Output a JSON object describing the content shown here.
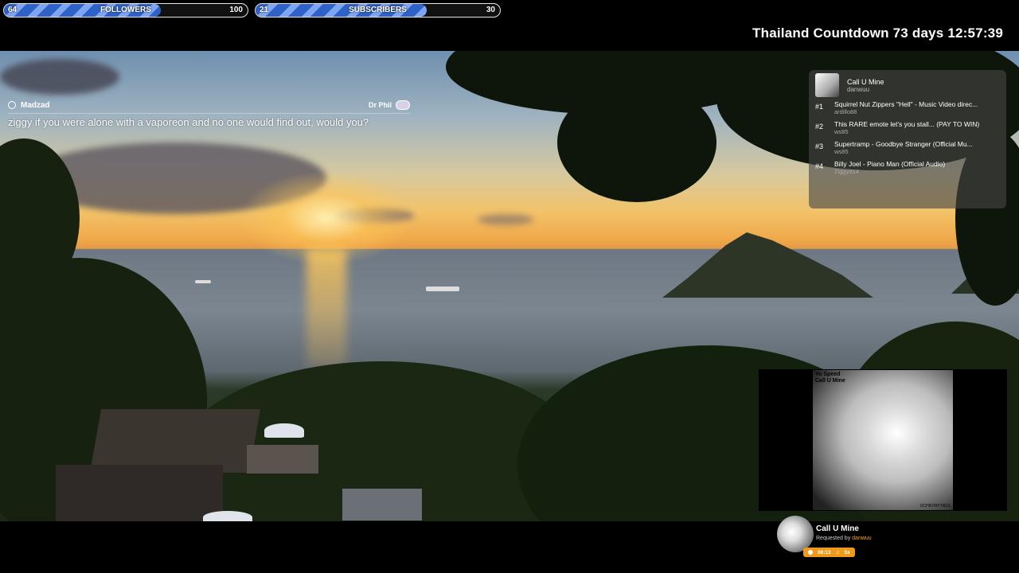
{
  "goals": {
    "followers": {
      "current": "64",
      "label": "FOLLOWERS",
      "target": "100"
    },
    "subscribers": {
      "current": "21",
      "label": "SUBSCRIBERS",
      "target": "30"
    }
  },
  "countdown": "Thailand Countdown 73 days 12:57:39",
  "chat": {
    "username": "Madzad",
    "tag": "Dr Phil",
    "message": "ziggy if you were alone with a vaporeon and no one would find out, would you?"
  },
  "queue": {
    "now_playing": {
      "title": "Call U Mine",
      "requester": "danwuu"
    },
    "items": [
      {
        "num": "#1",
        "title": "Squirrel Nut Zippers \"Hell\" - Music Video direc...",
        "requester": "ardillo88"
      },
      {
        "num": "#2",
        "title": "This RARE emote let's you stall... (PAY TO WIN)",
        "requester": "ws85"
      },
      {
        "num": "#3",
        "title": "Supertramp - Goodbye Stranger (Official Mu...",
        "requester": "ws85"
      },
      {
        "num": "#4",
        "title": "Billy Joel - Piano Man (Official Audio)",
        "requester": "Ziggy314"
      }
    ]
  },
  "album": {
    "artist": "Yo Speed",
    "title": "Call U Mine",
    "label": "OCHINTAYTRES"
  },
  "player": {
    "title": "Call U Mine",
    "requested_by_label": "Requested by",
    "requester": "danwuu",
    "time": "06:13",
    "count": "5x"
  }
}
